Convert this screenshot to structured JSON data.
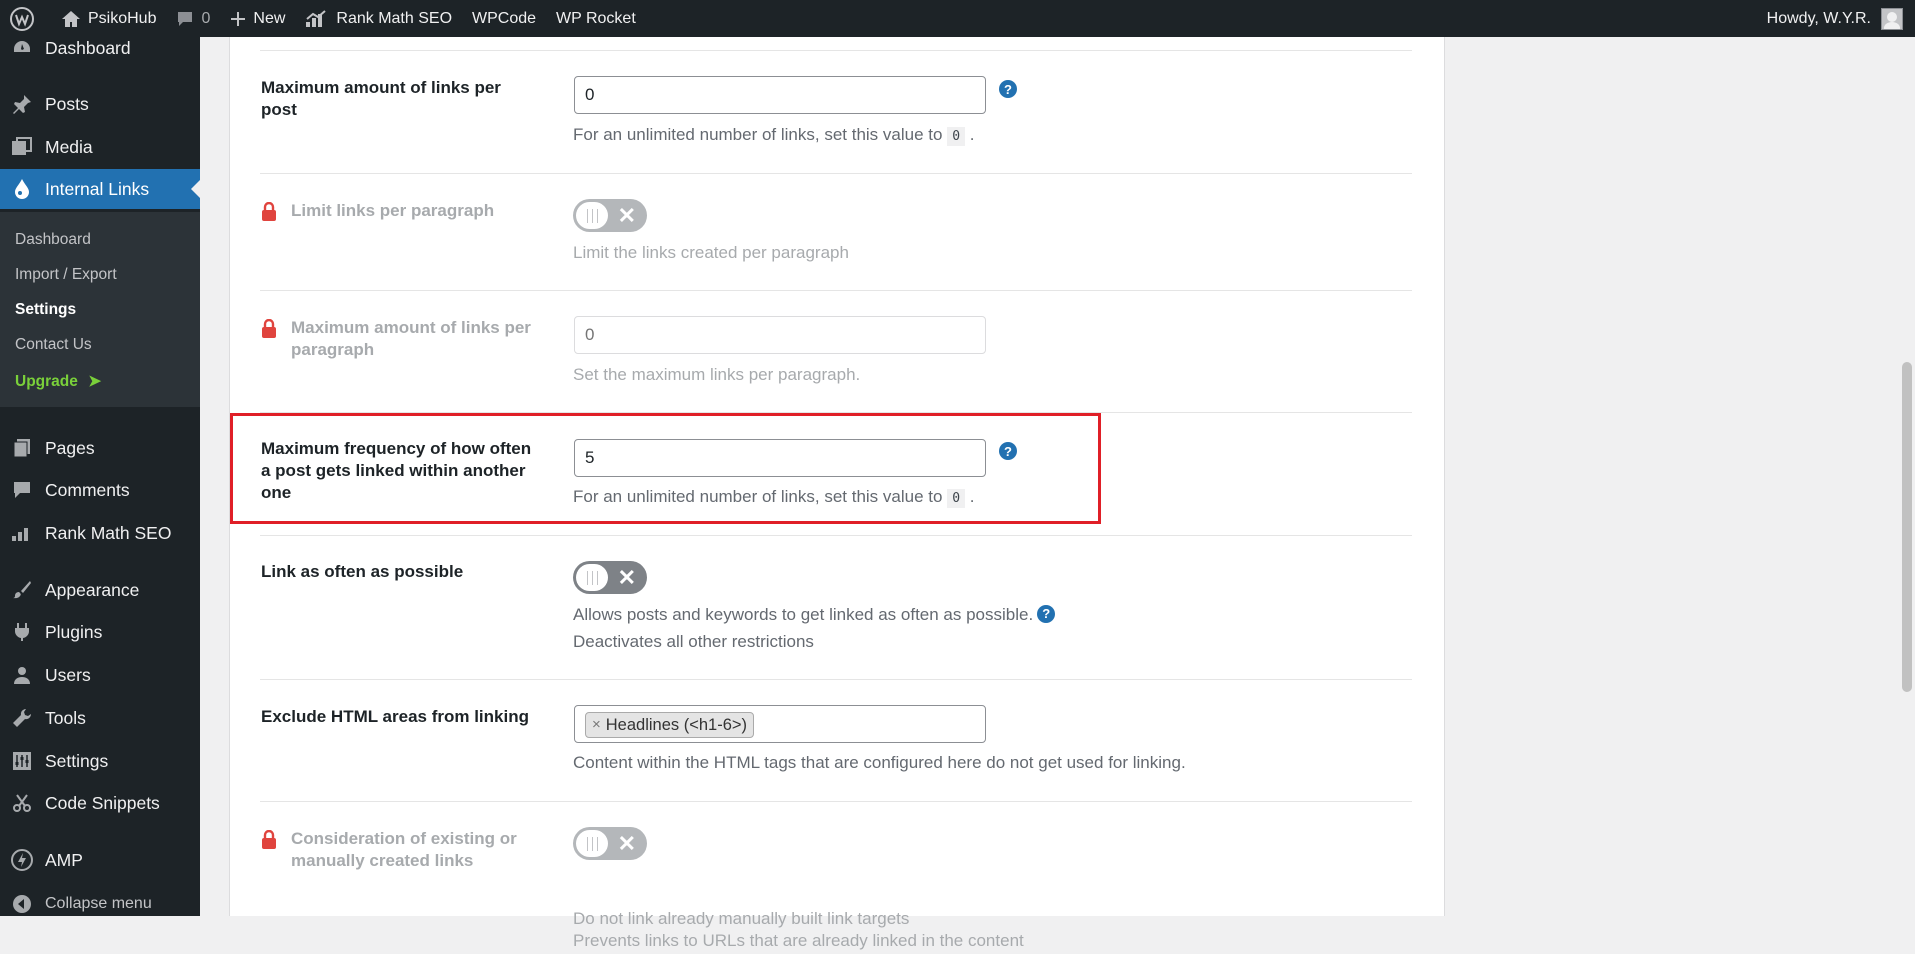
{
  "adminbar": {
    "site_name": "PsikoHub",
    "comments_count": "0",
    "new_label": "New",
    "rankmath_label": "Rank Math SEO",
    "wpcode_label": "WPCode",
    "wprocket_label": "WP Rocket",
    "howdy": "Howdy, W.Y.R."
  },
  "sidebar": {
    "dashboard": "Dashboard",
    "posts": "Posts",
    "media": "Media",
    "internal_links": "Internal Links",
    "sub": {
      "dashboard": "Dashboard",
      "import_export": "Import / Export",
      "settings": "Settings",
      "contact": "Contact Us",
      "upgrade": "Upgrade"
    },
    "pages": "Pages",
    "comments": "Comments",
    "rank_math": "Rank Math SEO",
    "appearance": "Appearance",
    "plugins": "Plugins",
    "users": "Users",
    "tools": "Tools",
    "settings": "Settings",
    "code_snippets": "Code Snippets",
    "amp": "AMP",
    "collapse": "Collapse menu"
  },
  "settings": {
    "max_links_post": {
      "label": "Maximum amount of links per post",
      "value": "0",
      "desc_prefix": "For an unlimited number of links, set this value to",
      "desc_code": "0",
      "desc_suffix": "."
    },
    "limit_paragraph": {
      "label": "Limit links per paragraph",
      "desc": "Limit the links created per paragraph"
    },
    "max_links_paragraph": {
      "label": "Maximum amount of links per paragraph",
      "placeholder": "0",
      "desc": "Set the maximum links per paragraph."
    },
    "max_frequency": {
      "label": "Maximum frequency of how often a post gets linked within another one",
      "value": "5",
      "desc_prefix": "For an unlimited number of links, set this value to",
      "desc_code": "0",
      "desc_suffix": "."
    },
    "link_often": {
      "label": "Link as often as possible",
      "desc1": "Allows posts and keywords to get linked as often as possible.",
      "desc2": "Deactivates all other restrictions"
    },
    "exclude_html": {
      "label": "Exclude HTML areas from linking",
      "chip": "Headlines (<h1-6>)",
      "chip_remove": "×",
      "desc": "Content within the HTML tags that are configured here do not get used for linking."
    },
    "existing_links": {
      "label": "Consideration of existing or manually created links",
      "desc1": "Do not link already manually built link targets",
      "desc2": "Prevents links to URLs that are already linked in the content"
    }
  },
  "colors": {
    "admin_dark": "#1d2327",
    "accent": "#2271b1",
    "highlight_border": "#e01f27",
    "upgrade_green": "#7ad03a"
  }
}
